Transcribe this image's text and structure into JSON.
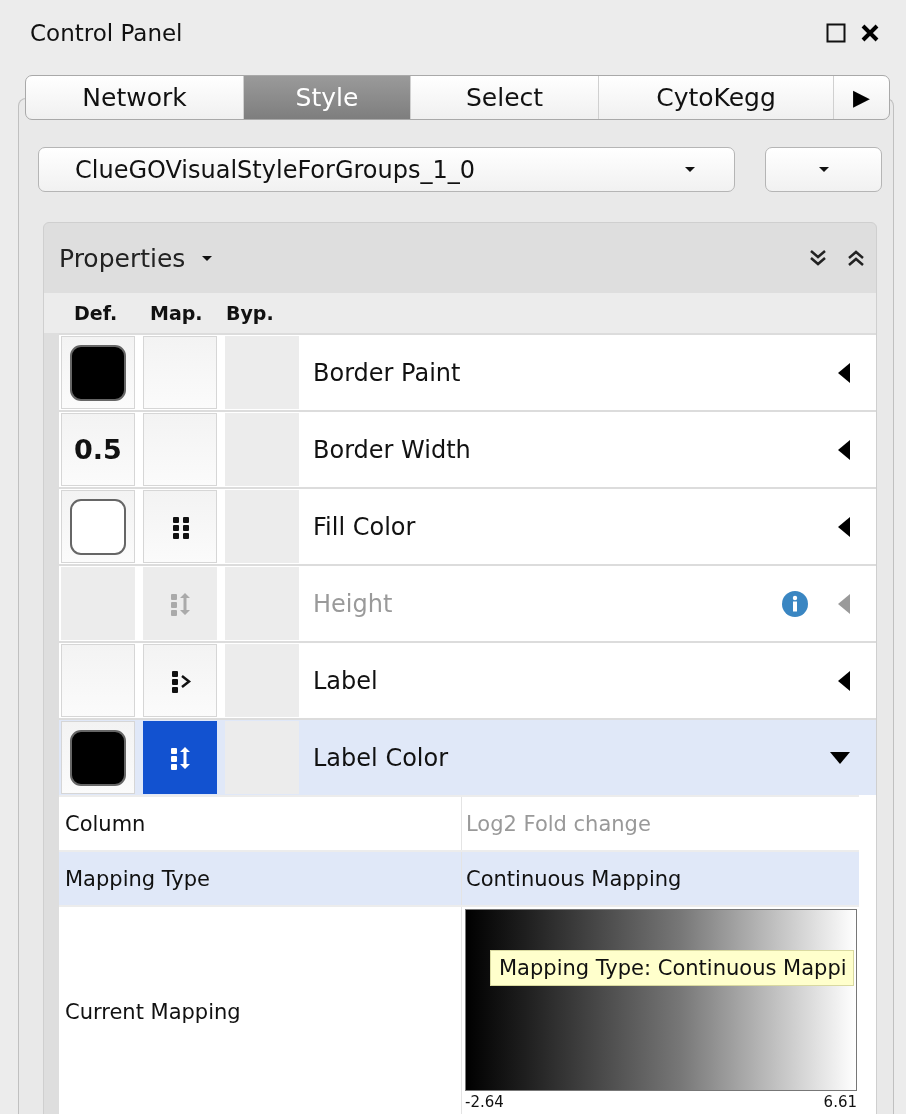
{
  "window": {
    "title": "Control Panel"
  },
  "tabs": [
    {
      "label": "Network",
      "selected": false
    },
    {
      "label": "Style",
      "selected": true
    },
    {
      "label": "Select",
      "selected": false
    },
    {
      "label": "CytoKegg",
      "selected": false
    }
  ],
  "tab_scroll": "▶",
  "style_selector": {
    "value": "ClueGOVisualStyleForGroups_1_0"
  },
  "properties": {
    "title": "Properties",
    "columns": [
      "Def.",
      "Map.",
      "Byp."
    ],
    "rows": [
      {
        "name": "Border Paint",
        "default": {
          "kind": "swatch",
          "color": "#000000"
        },
        "mapping": {
          "kind": "none"
        },
        "disabled": false,
        "info": false,
        "expanded": false,
        "selected": false
      },
      {
        "name": "Border Width",
        "default": {
          "kind": "number",
          "text": "0.5"
        },
        "mapping": {
          "kind": "none"
        },
        "disabled": false,
        "info": false,
        "expanded": false,
        "selected": false
      },
      {
        "name": "Fill Color",
        "default": {
          "kind": "swatch",
          "color": "#ffffff"
        },
        "mapping": {
          "kind": "discrete"
        },
        "disabled": false,
        "info": false,
        "expanded": false,
        "selected": false
      },
      {
        "name": "Height",
        "default": {
          "kind": "none"
        },
        "mapping": {
          "kind": "continuous"
        },
        "disabled": true,
        "info": true,
        "expanded": false,
        "selected": false
      },
      {
        "name": "Label",
        "default": {
          "kind": "none"
        },
        "mapping": {
          "kind": "passthrough"
        },
        "disabled": false,
        "info": false,
        "expanded": false,
        "selected": false
      },
      {
        "name": "Label Color",
        "default": {
          "kind": "swatch",
          "color": "#000000"
        },
        "mapping": {
          "kind": "continuous"
        },
        "disabled": false,
        "info": false,
        "expanded": true,
        "selected": true,
        "details": [
          {
            "kind": "text",
            "label": "Column",
            "value": "Log2 Fold change",
            "disabled": true,
            "selected": false
          },
          {
            "kind": "text",
            "label": "Mapping Type",
            "value": "Continuous Mapping",
            "disabled": false,
            "selected": true
          },
          {
            "kind": "gradient",
            "label": "Current Mapping",
            "min_label": "-2.64",
            "max_label": "6.61",
            "selected": false
          }
        ]
      }
    ]
  },
  "tooltip": {
    "text": "Mapping Type: Continuous Mappi"
  }
}
